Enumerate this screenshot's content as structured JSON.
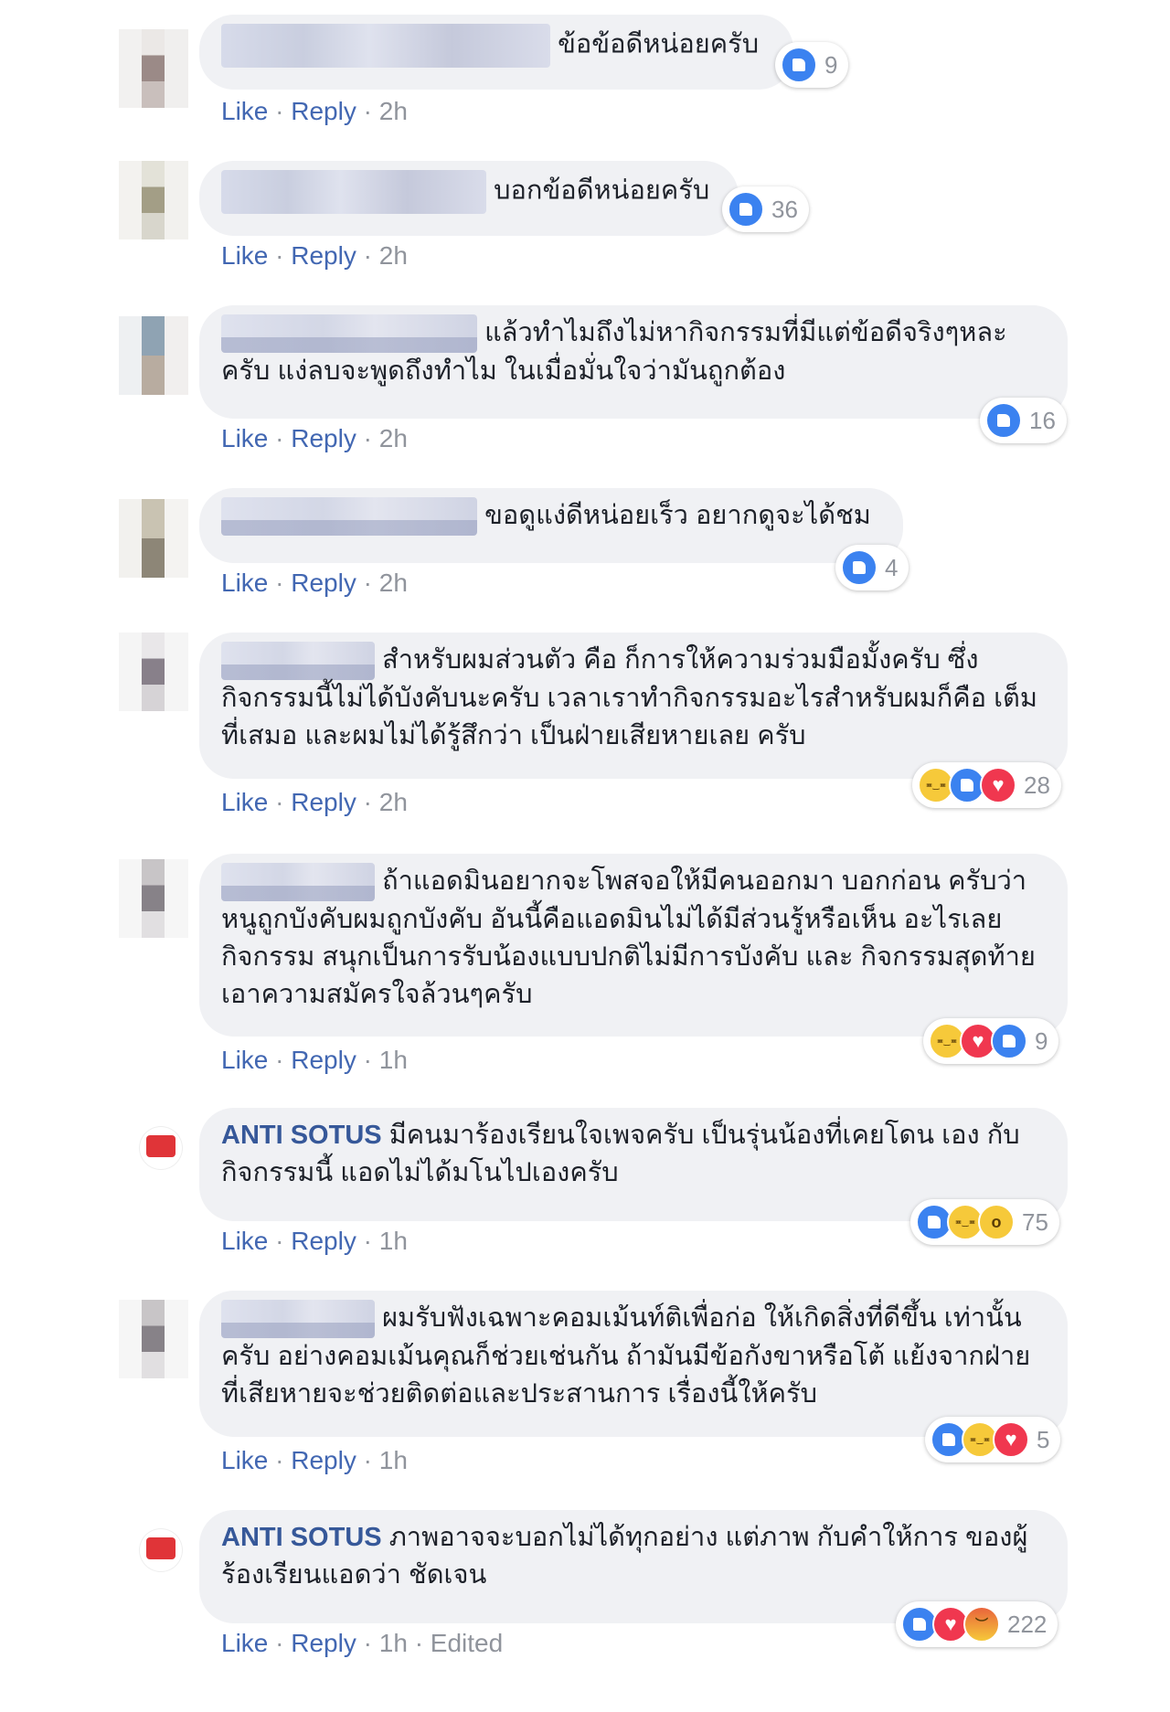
{
  "labels": {
    "like": "Like",
    "reply": "Reply",
    "dot": "·"
  },
  "comments": [
    {
      "author": "",
      "text": "ข้อข้อดีหน่อยครับ",
      "time": "2h",
      "reactions": [
        "like"
      ],
      "count": "9"
    },
    {
      "author": "",
      "text": "บอกข้อดีหน่อยครับ",
      "time": "2h",
      "reactions": [
        "like"
      ],
      "count": "36"
    },
    {
      "author": "",
      "text": "แล้วทำไมถึงไม่หากิจกรรมที่มีแต่ข้อดีจริงๆหละ ครับ แง่ลบจะพูดถึงทำไม ในเมื่อมั่นใจว่ามันถูกต้อง",
      "time": "2h",
      "reactions": [
        "like"
      ],
      "count": "16"
    },
    {
      "author": "",
      "text": "ขอดูแง่ดีหน่อยเร็ว อยากดูจะได้ชม",
      "time": "2h",
      "reactions": [
        "like"
      ],
      "count": "4"
    },
    {
      "author": "",
      "text": "สำหรับผมส่วนตัว คือ ก็การให้ความร่วมมือมั้งครับ ซึ่ง กิจกรรมนี้ไม่ได้บังคับนะครับ เวลาเราทำกิจกรรมอะไรสำหรับผมก็คือ เต็มที่เสมอ และผมไม่ได้รู้สึกว่า เป็นฝ่ายเสียหายเลย ครับ",
      "time": "2h",
      "reactions": [
        "haha",
        "like",
        "love"
      ],
      "count": "28"
    },
    {
      "author": "",
      "text": "ถ้าแอดมินอยากจะโพสจอให้มีคนออกมา บอกก่อน ครับว่าหนูถูกบังคับผมถูกบังคับ อันนี้คือแอดมินไม่ได้มีส่วนรู้หรือเห็น อะไรเลย กิจกรรม สนุกเป็นการรับน้องแบบปกติไม่มีการบังคับ และ กิจกรรมสุดท้ายเอาความสมัครใจล้วนๆครับ",
      "time": "1h",
      "reactions": [
        "haha",
        "love",
        "like"
      ],
      "count": "9"
    },
    {
      "author": "ANTI SOTUS",
      "text": "มีคนมาร้องเรียนใจเพจครับ เป็นรุ่นน้องที่เคยโดน เอง กับกิจกรรมนี้ แอดไม่ได้มโนไปเองครับ",
      "time": "1h",
      "reactions": [
        "like",
        "haha",
        "wow"
      ],
      "count": "75"
    },
    {
      "author": "",
      "text": "ผมรับฟังเฉพาะคอมเม้นท์ติเพื่อก่อ ให้เกิดสิ่งที่ดีขึ้น เท่านั้นครับ อย่างคอมเม้นคุณก็ช่วยเช่นกัน ถ้ามันมีข้อกังขาหรือโต้ แย้งจากฝ่ายที่เสียหายจะช่วยติดต่อและประสานการ เรื่องนี้ให้ครับ",
      "time": "1h",
      "reactions": [
        "like",
        "haha",
        "love"
      ],
      "count": "5"
    },
    {
      "author": "ANTI SOTUS",
      "text": "ภาพอาจจะบอกไม่ได้ทุกอย่าง แต่ภาพ กับคำให้การ ของผู้ร้องเรียนแอดว่า ชัดเจน",
      "time": "1h",
      "edited": "Edited",
      "reactions": [
        "like",
        "love",
        "angry"
      ],
      "count": "222"
    }
  ]
}
